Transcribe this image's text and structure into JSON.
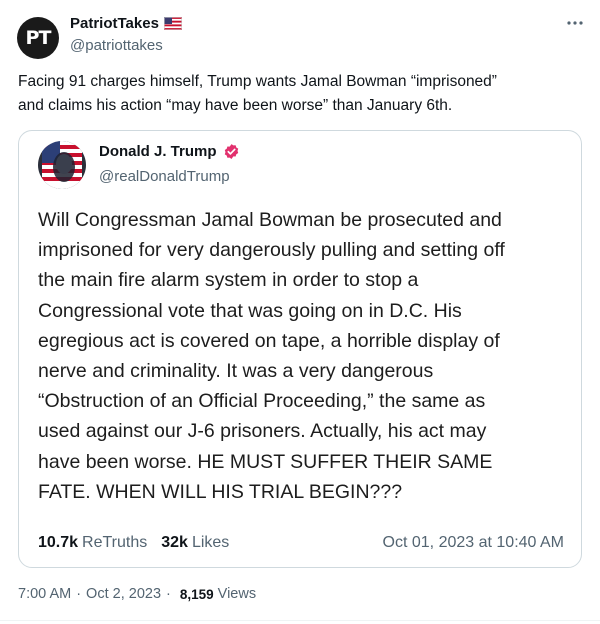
{
  "post": {
    "author": {
      "avatar_initials": "PT",
      "name": "PatriotTakes",
      "handle": "@patriottakes",
      "flag_icon": "us-flag-icon"
    },
    "text_line1": "Facing 91 charges himself, Trump wants Jamal Bowman “imprisoned”",
    "text_line2": "and claims his action “may have been worse” than January 6th.",
    "more_icon": "more-dots-icon",
    "quote": {
      "author": {
        "name": "Donald J. Trump",
        "handle": "@realDonaldTrump",
        "verified_icon": "verified-badge-icon"
      },
      "lines": [
        "Will Congressman Jamal Bowman be prosecuted and",
        "imprisoned for very dangerously pulling and setting off",
        "the main fire alarm system in order to stop a",
        "Congressional vote that was going on in D.C. His",
        "egregious act is covered on tape, a horrible display of",
        "nerve and criminality. It was a very dangerous",
        "“Obstruction of an Official Proceeding,” the same as",
        "used against our J-6 prisoners. Actually, his act may",
        "have been worse. HE MUST SUFFER THEIR SAME",
        "FATE. WHEN WILL HIS TRIAL BEGIN???"
      ],
      "retruths_count": "10.7k",
      "retruths_label": "ReTruths",
      "likes_count": "32k",
      "likes_label": "Likes",
      "date": "Oct 01, 2023 at 10:40 AM"
    },
    "meta": {
      "time": "7:00 AM",
      "date": "Oct 2, 2023",
      "views_count": "8,159",
      "views_label": "Views",
      "separator": "·"
    }
  },
  "colors": {
    "text_primary": "#0f1419",
    "text_secondary": "#536471",
    "border": "#cfd9de",
    "verified_pink": "#e2316e"
  }
}
